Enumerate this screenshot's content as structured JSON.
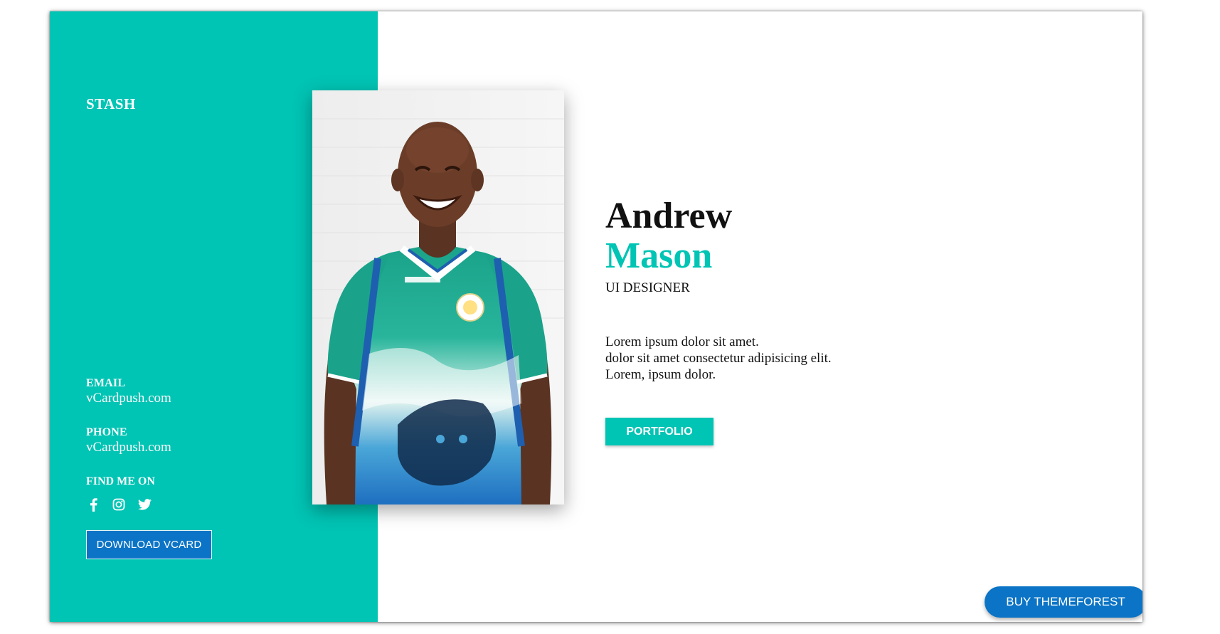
{
  "brand": {
    "name": "STASH"
  },
  "contact": {
    "email_label": "EMAIL",
    "email_value": "vCardpush.com",
    "phone_label": "PHONE",
    "phone_value": "vCardpush.com",
    "find_label": "FIND ME ON",
    "social": [
      "facebook-icon",
      "instagram-icon",
      "twitter-icon"
    ]
  },
  "actions": {
    "download_label": "DOWNLOAD VCARD",
    "portfolio_label": "PORTFOLIO",
    "buy_label": "BUY THEMEFOREST"
  },
  "profile": {
    "first_name": "Andrew",
    "last_name": "Mason",
    "role": "UI DESIGNER",
    "bio_lines": [
      "Lorem ipsum dolor sit amet.",
      "dolor sit amet consectetur adipisicing elit.",
      "Lorem, ipsum dolor."
    ]
  },
  "colors": {
    "accent": "#00c4b4",
    "button_blue": "#0b74c6",
    "text": "#111111"
  }
}
